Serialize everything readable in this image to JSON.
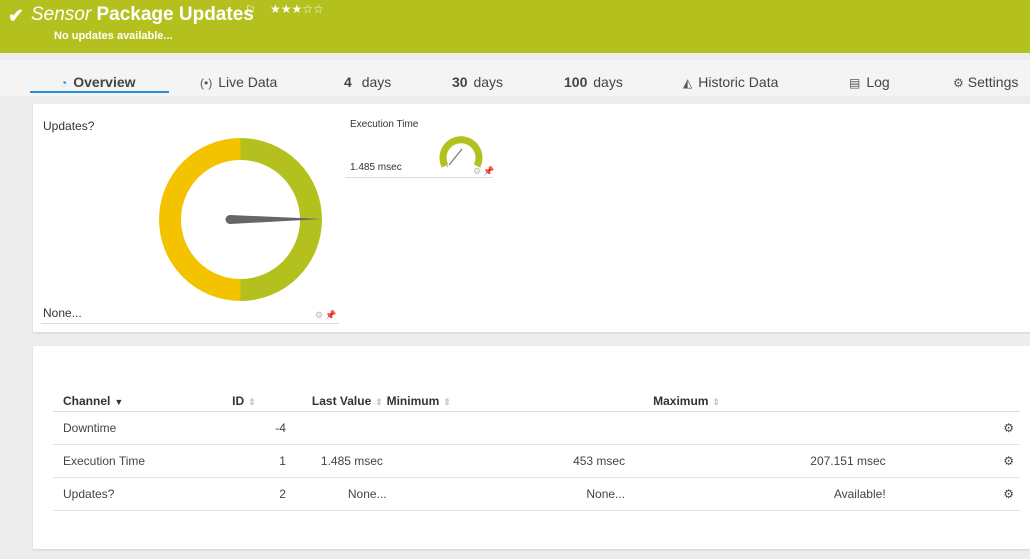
{
  "header": {
    "sensor_word": "Sensor",
    "sensor_name": "Package Updates",
    "flag_icon": "flag-icon",
    "stars": "★★★☆☆",
    "status": "No updates available...",
    "check_icon": "✔",
    "color": "#b4c01e"
  },
  "tabs": [
    {
      "icon": "gauge-icon",
      "bold": "Overview",
      "rest": ""
    },
    {
      "icon": "broadcast-icon",
      "bold": "",
      "rest": "Live Data"
    },
    {
      "icon": "",
      "bold": "4",
      "rest": "days"
    },
    {
      "icon": "",
      "bold": "30",
      "rest": "days"
    },
    {
      "icon": "",
      "bold": "100",
      "rest": "days"
    },
    {
      "icon": "area-chart-icon",
      "bold": "",
      "rest": "Historic Data"
    },
    {
      "icon": "log-icon",
      "bold": "",
      "rest": "Log"
    },
    {
      "icon": "gear-icon",
      "bold": "",
      "rest": "Settings"
    }
  ],
  "gauges": {
    "updates": {
      "title": "Updates?",
      "value": "None...",
      "segment_colors": [
        "#b4c01e",
        "#f4c300"
      ],
      "segment_fractions": [
        0.5,
        0.5
      ]
    },
    "execution": {
      "title": "Execution Time",
      "value": "1.485 msec",
      "color": "#b4c01e"
    }
  },
  "table": {
    "headers": {
      "channel": "Channel",
      "id": "ID",
      "last": "Last Value",
      "min": "Minimum",
      "max": "Maximum"
    },
    "rows": [
      {
        "channel": "Downtime",
        "id": "-4",
        "last": "",
        "min": "",
        "max": ""
      },
      {
        "channel": "Execution Time",
        "id": "1",
        "last": "1.485 msec",
        "min": "453 msec",
        "max": "207.151 msec"
      },
      {
        "channel": "Updates?",
        "id": "2",
        "last": "None...",
        "min": "None...",
        "max": "Available!"
      }
    ]
  }
}
